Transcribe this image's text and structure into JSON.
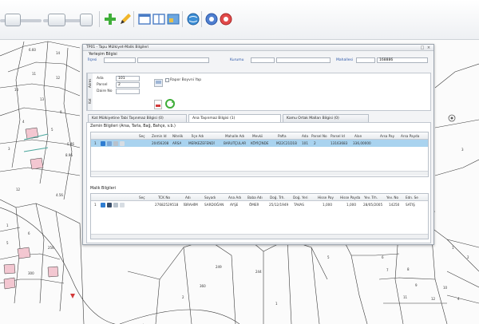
{
  "dialog": {
    "title": "TP01 - Tapu Mülkiyet-Malik Bilgileri",
    "controls": {
      "minimize": "□",
      "close": "×"
    }
  },
  "location": {
    "section_title": "Yerleşim Bilgisi",
    "ilce_label": "İlçesi",
    "kurum_label": "Kurumu",
    "mahalle_label": "Mahallesi",
    "mahalle_value": "168886"
  },
  "parcel": {
    "vtab_label": "Adres",
    "vtab2_label": "Kat",
    "ada_label": "Ada",
    "ada_value": "101",
    "parsel_label": "Parsel",
    "parsel_value": "2",
    "daire_label": "Daire No",
    "daire_value": "",
    "report_checkbox_label": "Rapor Boyvni Yap"
  },
  "tabs": [
    {
      "label": "Kat Mülkiyetine Tabi Taşınmaz Bilgisi  (0)"
    },
    {
      "label": "Ana Taşınmaz Bilgisi  (1)"
    },
    {
      "label": "Kamu Ortak Malları Bilgisi  (0)"
    }
  ],
  "zemin": {
    "title": "Zemin Bilgileri (Arsa, Tarla, Bağ, Bahçe, v.b.)",
    "columns": [
      "Seç",
      "Zemin Id",
      "Nitelik",
      "İlçe Adı",
      "Mahalle Adı",
      "Mevkii",
      "Pafta",
      "Ada",
      "Parsel No",
      "Parsel Id",
      "Alan",
      "Arsa Pay",
      "Arsa Payda"
    ],
    "rows": [
      {
        "num": "1",
        "zemin_id": "20456208",
        "nitelik": "ARSA",
        "ilce": "MERKEZEFENDİ",
        "mahalle": "BARUTÇULAR",
        "mevkii": "KÖYİÇİNDE",
        "pafta": "M22C21D1B",
        "ada": "101",
        "parsel": "2",
        "parsel_id": "13163683",
        "alan": "336,00000",
        "arsa_pay": "",
        "arsa_payda": ""
      }
    ]
  },
  "malik": {
    "title": "Malik Bilgileri",
    "columns": [
      "Seç",
      "TCK No",
      "Adı",
      "Soyadı",
      "Ana Adı",
      "Baba Adı",
      "Doğ. Trh.",
      "Doğ. Yeri",
      "Hisse Pay",
      "Hisse Payda",
      "Yev. Trh.",
      "Yev. No",
      "Edn. Se"
    ],
    "rows": [
      {
        "num": "1",
        "tck": "27682529518",
        "adi": "İBRAHİM",
        "soyadi": "SARDOĞAN",
        "ana": "AYŞE",
        "baba": "ÖMER",
        "dtrh": "25/12/1949",
        "dyeri": "TAVAS",
        "hpay": "1,000",
        "hpayda": "1,000",
        "ytrh": "28/05/2005",
        "yno": "14250",
        "edn": "SATIŞ"
      }
    ]
  },
  "map_labels": [
    "6.60",
    "14",
    "11",
    "12",
    "10",
    "13",
    "9",
    "4",
    "5",
    "3",
    "2",
    "1",
    "7",
    "8",
    "16",
    "15",
    "12",
    "0.46",
    "8.96",
    "4.56",
    "6.15",
    "10",
    "11",
    "2",
    "3",
    "1",
    "6",
    "5",
    "256",
    "300",
    "249",
    "244",
    "360",
    "2",
    "1",
    "5",
    "6",
    "7",
    "8",
    "9",
    "10",
    "11",
    "12",
    "4",
    "3",
    "1",
    "2",
    "3",
    "4",
    "5"
  ],
  "colors": {
    "accent_blue": "#2a56a8",
    "selected_row": "#a9d3ef",
    "pink_parcel": "#f3c7d1",
    "teal_line": "#4aa79d"
  },
  "toolbar_icons": [
    "plus-icon",
    "pencil-icon",
    "window-icon",
    "map-icon",
    "globe-icon",
    "stop-icon"
  ]
}
